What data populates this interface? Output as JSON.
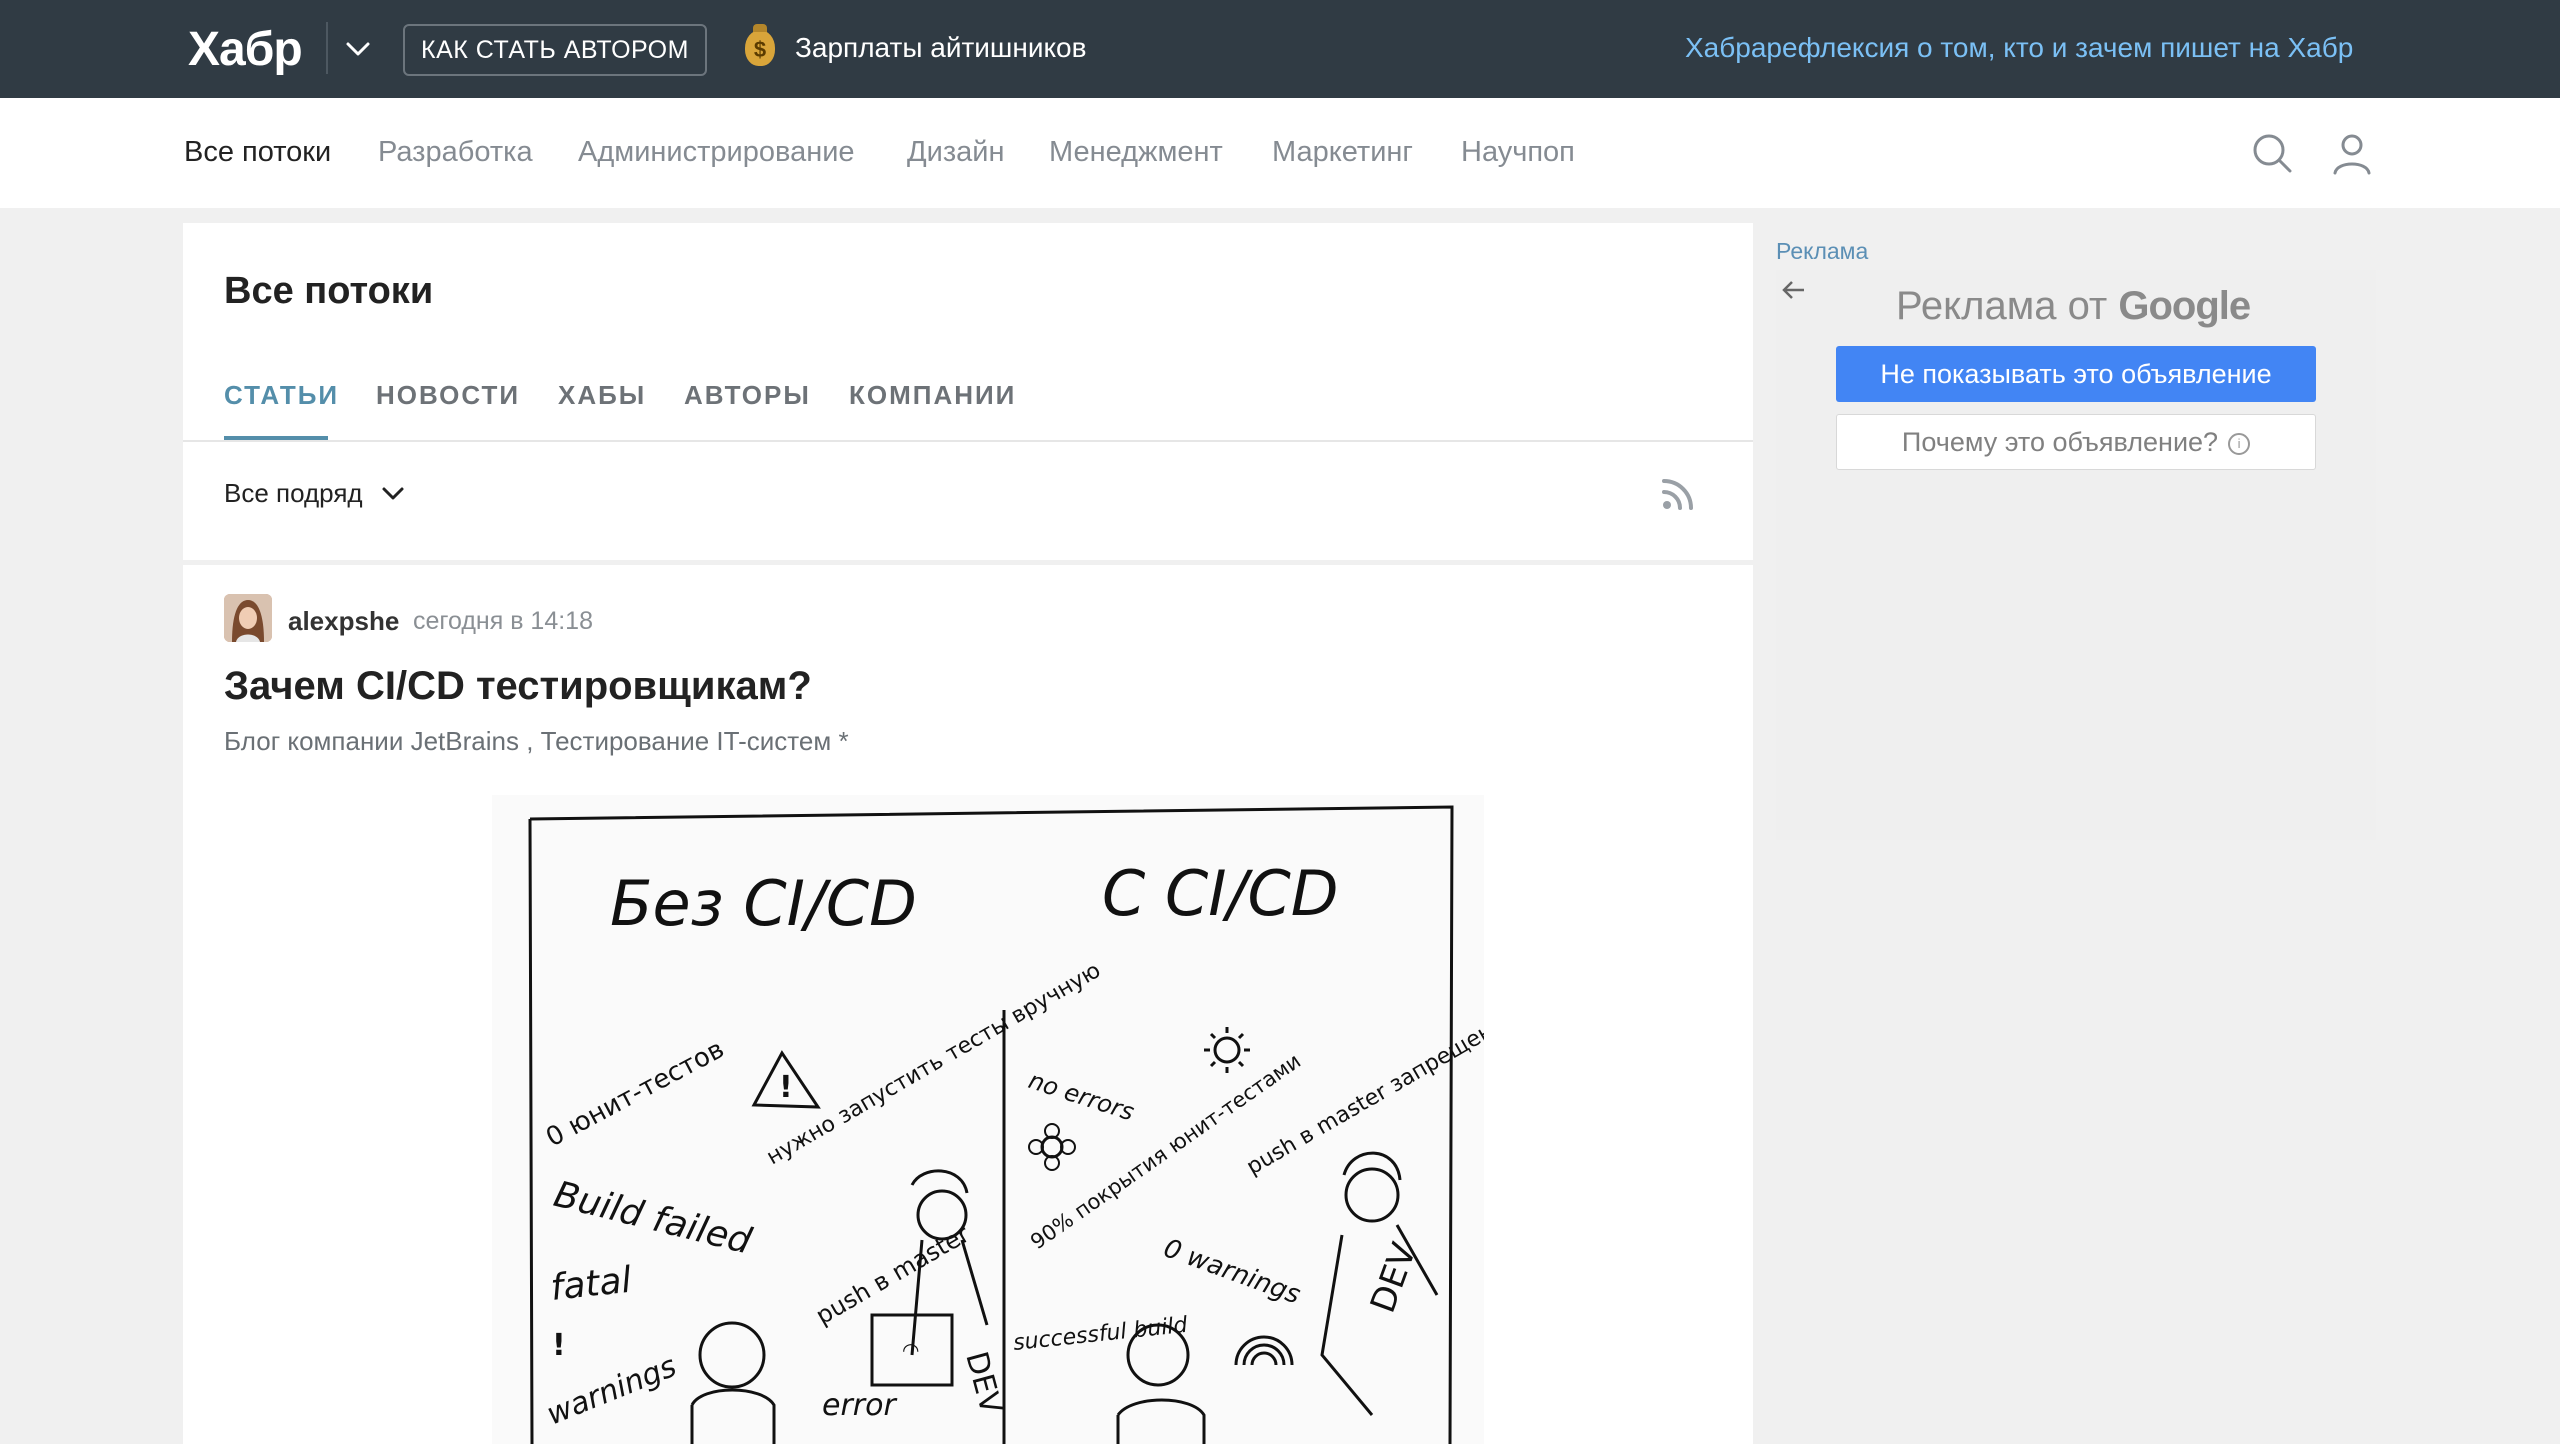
{
  "header": {
    "logo": "Хабр",
    "howto_button": "КАК СТАТЬ АВТОРОМ",
    "salary_link": "Зарплаты айтишников",
    "salary_emoji": "$",
    "promo_link": "Хабрарефлексия о том, кто и зачем пишет на Хабр"
  },
  "nav": {
    "items": [
      "Все потоки",
      "Разработка",
      "Администрирование",
      "Дизайн",
      "Менеджмент",
      "Маркетинг",
      "Научпоп"
    ],
    "active": "Все потоки"
  },
  "feed": {
    "title": "Все потоки",
    "tabs": [
      "СТАТЬИ",
      "НОВОСТИ",
      "ХАБЫ",
      "АВТОРЫ",
      "КОМПАНИИ"
    ],
    "active_tab": "СТАТЬИ",
    "filter": "Все подряд"
  },
  "article": {
    "author": "alexpshe",
    "time": "сегодня в 14:18",
    "title": "Зачем CI/CD тестировщикам?",
    "hub_1": "Блог компании JetBrains",
    "hub_separator": ",",
    "hub_2": "Тестирование IT-систем",
    "hub_2_mark": "*",
    "image": {
      "left_heading": "Без CI/CD",
      "right_heading": "С CI/CD",
      "left_notes": [
        "0 юнит-тестов",
        "нужно запустить тесты вручную",
        "Build failed",
        "fatal",
        "warnings",
        "push в master",
        "error"
      ],
      "right_notes": [
        "no errors",
        "push в master запрещен",
        "90% покрытия юнит-тестами",
        "0 warnings",
        "successful build"
      ],
      "badge": "DEV"
    }
  },
  "ad": {
    "label": "Реклама",
    "heading_prefix": "Реклама от",
    "heading_brand": "Google",
    "hide_button": "Не показывать это объявление",
    "why_button": "Почему это объявление?",
    "info_glyph": "i"
  },
  "colors": {
    "topbar": "#303b44",
    "accent_tab": "#548eaa",
    "promo_link": "#7bc0f5",
    "ad_button": "#4285f4"
  }
}
